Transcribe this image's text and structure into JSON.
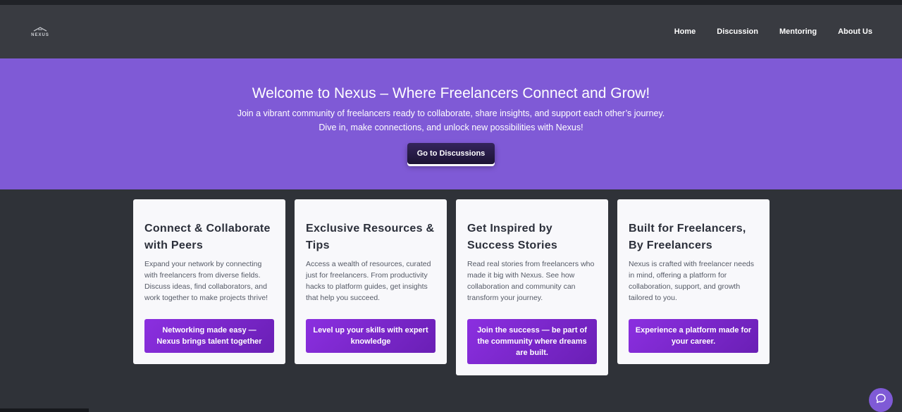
{
  "nav": {
    "logo_text": "NEXUS",
    "links": [
      "Home",
      "Discussion",
      "Mentoring",
      "About Us"
    ]
  },
  "hero": {
    "title": "Welcome to Nexus – Where Freelancers Connect and Grow!",
    "line1": "Join a vibrant community of freelancers ready to collaborate, share insights, and support each other’s journey.",
    "line2": "Dive in, make connections, and unlock new possibilities with Nexus!",
    "button": "Go to Discussions"
  },
  "cards": [
    {
      "title": "Connect & Collaborate with Peers",
      "text": "Expand your network by connecting with freelancers from diverse fields. Discuss ideas, find collaborators, and work together to make projects thrive!",
      "button": "Networking made easy — Nexus brings talent together"
    },
    {
      "title": "Exclusive Resources & Tips",
      "text": "Access a wealth of resources, curated just for freelancers. From productivity hacks to platform guides, get insights that help you succeed.",
      "button": "Level up your skills with expert knowledge"
    },
    {
      "title": "Get Inspired by Success Stories",
      "text": "Read real stories from freelancers who made it big with Nexus. See how collaboration and community can transform your journey.",
      "button": "Join the success — be part of the community where dreams are built."
    },
    {
      "title": "Built for Freelancers, By Freelancers",
      "text": "Nexus is crafted with freelancer needs in mind, offering a platform for collaboration, support, and growth tailored to you.",
      "button": "Experience a platform made for your career."
    }
  ],
  "colors": {
    "hero_bg": "#7f5ad6",
    "navbar_bg": "#393b41",
    "page_bg": "#2f3238",
    "card_button": "#8b2fe0"
  },
  "icons": [
    "nexus-logo",
    "chat-bubble-icon"
  ]
}
